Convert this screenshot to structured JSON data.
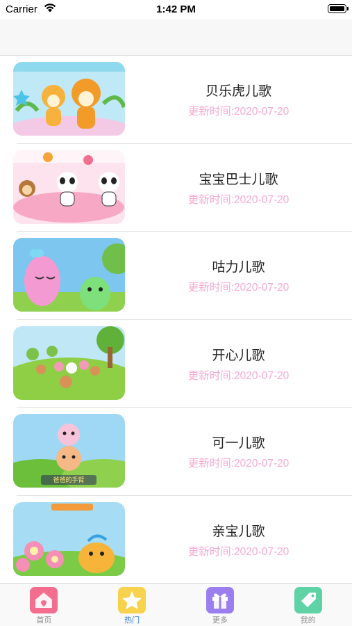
{
  "status_bar": {
    "carrier": "Carrier",
    "time": "1:42 PM"
  },
  "songs": [
    {
      "title": "贝乐虎儿歌",
      "date": "更新时间:2020-07-20",
      "thumb_icon": "tiger-cartoon-thumbnail"
    },
    {
      "title": "宝宝巴士儿歌",
      "date": "更新时间:2020-07-20",
      "thumb_icon": "panda-cartoon-thumbnail"
    },
    {
      "title": "咕力儿歌",
      "date": "更新时间:2020-07-20",
      "thumb_icon": "pink-character-thumbnail"
    },
    {
      "title": "开心儿歌",
      "date": "更新时间:2020-07-20",
      "thumb_icon": "animals-meadow-thumbnail"
    },
    {
      "title": "可一儿歌",
      "date": "更新时间:2020-07-20",
      "thumb_icon": "bears-thumbnail",
      "thumb_caption": "爸爸的手臂"
    },
    {
      "title": "亲宝儿歌",
      "date": "更新时间:2020-07-20",
      "thumb_icon": "flowers-duck-thumbnail"
    }
  ],
  "tabs": [
    {
      "label": "首页",
      "icon": "home-icon",
      "color": "#f36d8e"
    },
    {
      "label": "热门",
      "icon": "star-icon",
      "color": "#f7d24c",
      "active": true
    },
    {
      "label": "更多",
      "icon": "gift-icon",
      "color": "#9b7ff0"
    },
    {
      "label": "我的",
      "icon": "tag-icon",
      "color": "#5fd2a6"
    }
  ],
  "colors": {
    "accent": "#2f7bd7",
    "date_text": "#f6a9d3",
    "tab_inactive": "#8e8e8e"
  }
}
